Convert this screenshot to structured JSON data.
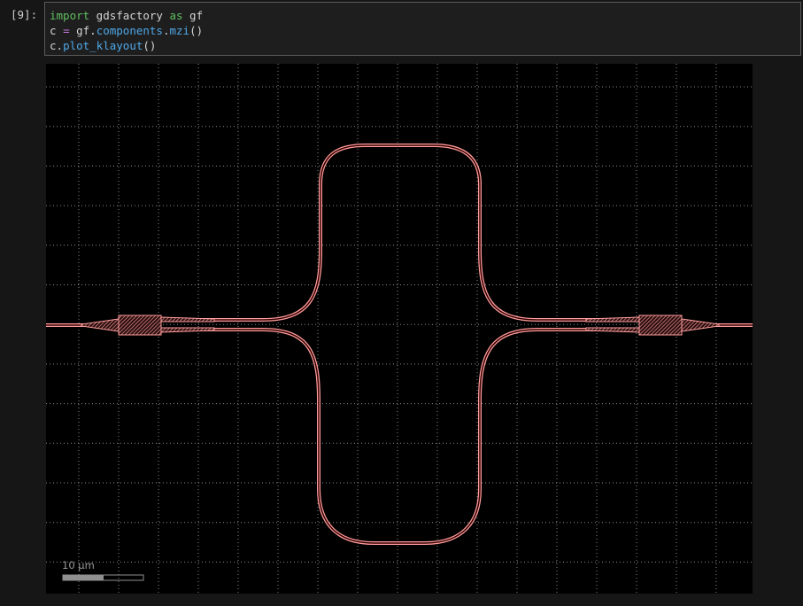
{
  "cell": {
    "prompt": "[9]:",
    "code_lines": [
      [
        {
          "text": "import",
          "cls": "tok-kw"
        },
        {
          "text": " gdsfactory ",
          "cls": "tok-name"
        },
        {
          "text": "as",
          "cls": "tok-kw"
        },
        {
          "text": " gf",
          "cls": "tok-name"
        }
      ],
      [
        {
          "text": "c ",
          "cls": "tok-name"
        },
        {
          "text": "=",
          "cls": "tok-op"
        },
        {
          "text": " gf",
          "cls": "tok-name"
        },
        {
          "text": ".",
          "cls": "tok-name"
        },
        {
          "text": "components",
          "cls": "tok-attr"
        },
        {
          "text": ".",
          "cls": "tok-name"
        },
        {
          "text": "mzi",
          "cls": "tok-attr"
        },
        {
          "text": "()",
          "cls": "tok-paren"
        }
      ],
      [
        {
          "text": "c",
          "cls": "tok-name"
        },
        {
          "text": ".",
          "cls": "tok-name"
        },
        {
          "text": "plot_klayout",
          "cls": "tok-attr"
        },
        {
          "text": "()",
          "cls": "tok-paren"
        }
      ]
    ]
  },
  "output": {
    "scale_bar_label": "10 µm",
    "colors": {
      "background": "#000000",
      "grid": "#8a8a8a",
      "waveguide": "#ff9d9d",
      "scale_bar": "#8f8f8f"
    },
    "component": "mzi"
  }
}
